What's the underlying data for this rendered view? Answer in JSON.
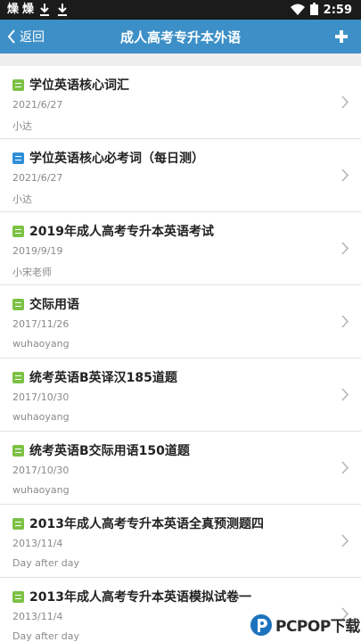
{
  "status_bar": {
    "app_icons": [
      "燥",
      "燥"
    ],
    "time": "2:59"
  },
  "nav": {
    "back_label": "返回",
    "title": "成人高考专升本外语"
  },
  "items": [
    {
      "title": "学位英语核心词汇",
      "date": "2021/6/27",
      "author": "小达",
      "icon": "green-document-icon"
    },
    {
      "title": "学位英语核心必考词（每日测）",
      "date": "2021/6/27",
      "author": "小达",
      "icon": "blue-quiz-icon"
    },
    {
      "title": "2019年成人高考专升本英语考试",
      "date": "2019/9/19",
      "author": "小宋老师",
      "icon": "green-document-icon"
    },
    {
      "title": "交际用语",
      "date": "2017/11/26",
      "author": "wuhaoyang",
      "icon": "green-document-icon"
    },
    {
      "title": "统考英语B英译汉185道题",
      "date": "2017/10/30",
      "author": "wuhaoyang",
      "icon": "green-document-icon"
    },
    {
      "title": "统考英语B交际用语150道题",
      "date": "2017/10/30",
      "author": "wuhaoyang",
      "icon": "green-document-icon"
    },
    {
      "title": "2013年成人高考专升本英语全真预测题四",
      "date": "2013/11/4",
      "author": "Day after day",
      "icon": "green-document-icon"
    },
    {
      "title": "2013年成人高考专升本英语模拟试卷一",
      "date": "2013/11/4",
      "author": "Day after day",
      "icon": "green-document-icon"
    }
  ],
  "watermark": {
    "text": "PCPOP下载"
  },
  "colors": {
    "nav_bar": "#3d8fc7",
    "status_bar": "#1b1b1b",
    "icon_green": "#7cc245",
    "icon_blue": "#2e8fd9"
  }
}
